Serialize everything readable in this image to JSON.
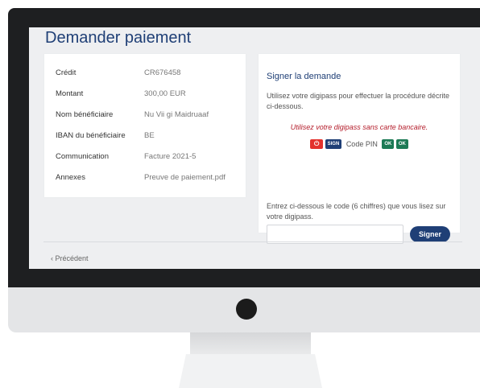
{
  "page": {
    "title": "Demander paiement"
  },
  "details": [
    {
      "label": "Crédit",
      "value": "CR676458"
    },
    {
      "label": "Montant",
      "value": "300,00 EUR"
    },
    {
      "label": "Nom bénéficiaire",
      "value": "Nu Vii gi Maidruaaf"
    },
    {
      "label": "IBAN du bénéficiaire",
      "value": "BE"
    },
    {
      "label": "Communication",
      "value": "Facture 2021-5"
    },
    {
      "label": "Annexes",
      "value": "Preuve de paiement.pdf"
    }
  ],
  "sign": {
    "title": "Signer la demande",
    "description": "Utilisez votre digipass pour effectuer la procédure décrite ci-dessous.",
    "warning": "Utilisez votre digipass sans carte bancaire.",
    "keys": {
      "power": "⏻",
      "sign": "SIGN",
      "pin": "Code PIN",
      "ok1": "OK",
      "ok2": "OK"
    },
    "code_instruction": "Entrez ci-dessous le code (6 chiffres) que vous lisez sur votre digipass.",
    "code_value": "",
    "button": "Signer"
  },
  "nav": {
    "previous": "‹ Précédent"
  },
  "colors": {
    "primary": "#1f3f76",
    "warning": "#b41d2b",
    "power_key": "#e3322d",
    "ok_key": "#1c7a55"
  }
}
